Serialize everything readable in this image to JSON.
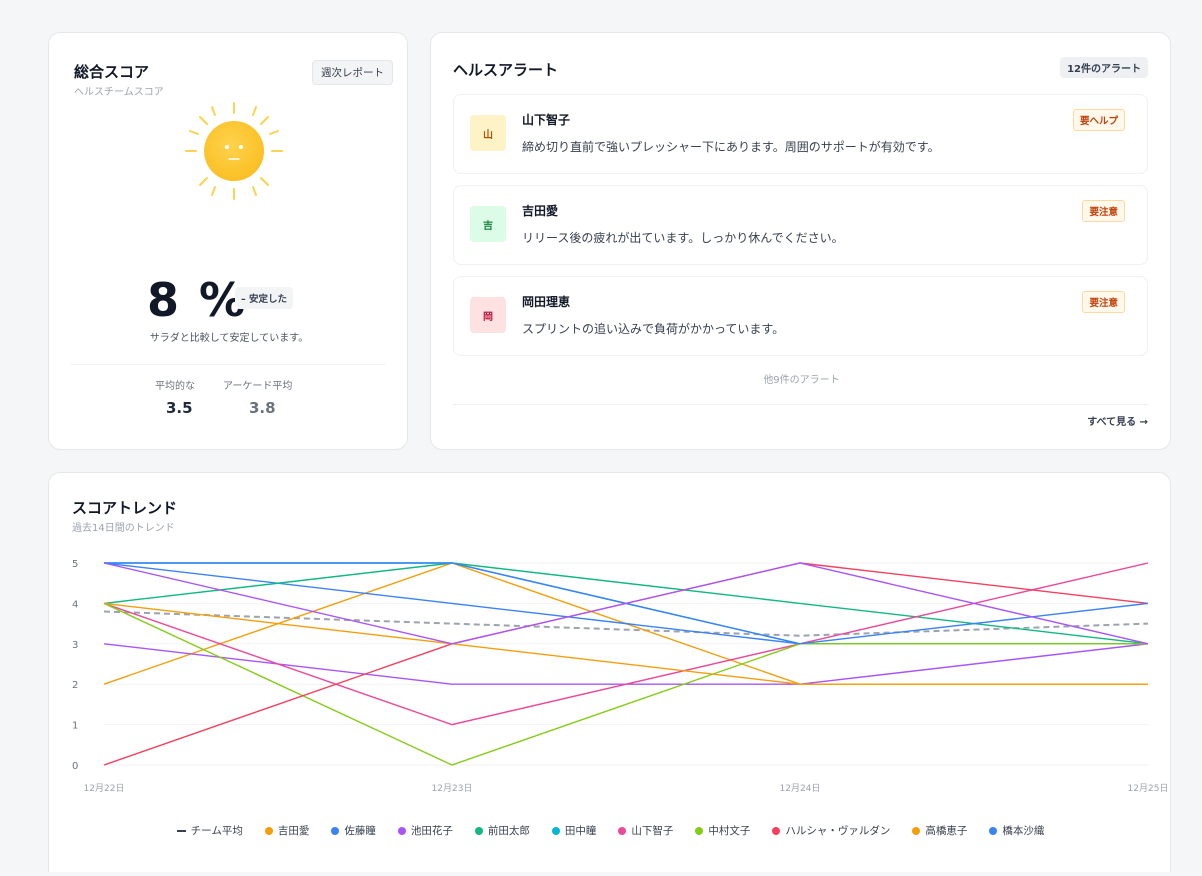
{
  "score_card": {
    "title": "総合スコア",
    "subtitle": "ヘルスチームスコア",
    "report_button": "週次レポート",
    "mood_icon": "sun-face-icon",
    "score": "8 %",
    "trend_badge": "– 安定した",
    "comparison": "サラダと比較して安定しています。",
    "stats": [
      {
        "label": "平均的な",
        "value": "3.5"
      },
      {
        "label": "アーケード平均",
        "value": "3.8"
      }
    ]
  },
  "alerts_card": {
    "title": "ヘルスアラート",
    "count_badge": "12件のアラート",
    "items": [
      {
        "avatar": "山",
        "name": "山下智子",
        "message": "締め切り直前で強いプレッシャー下にあります。周囲のサポートが有効です。",
        "tag": "要ヘルプ",
        "avatar_bg": "#fef3c7",
        "avatar_color": "#b45309"
      },
      {
        "avatar": "吉",
        "name": "吉田愛",
        "message": "リリース後の疲れが出ています。しっかり休んでください。",
        "tag": "要注意",
        "avatar_bg": "#dcfce7",
        "avatar_color": "#15803d"
      },
      {
        "avatar": "岡",
        "name": "岡田理恵",
        "message": "スプリントの追い込みで負荷がかかっています。",
        "tag": "要注意",
        "avatar_bg": "#fee2e2",
        "avatar_color": "#be123c"
      }
    ],
    "more_text": "他9件のアラート",
    "see_all": "すべて見る →"
  },
  "trend_card": {
    "title": "スコアトレンド",
    "subtitle": "過去14日間のトレンド"
  },
  "chart_data": {
    "type": "line",
    "title": "スコアトレンド",
    "subtitle": "過去14日間のトレンド",
    "x": [
      "12月22日",
      "12月23日",
      "12月24日",
      "12月25日"
    ],
    "ylim": [
      0,
      5
    ],
    "yticks": [
      "0",
      "1",
      "2",
      "3",
      "4",
      "5"
    ],
    "grid": true,
    "legend": "bottom",
    "series": [
      {
        "name": "チーム平均",
        "values": [
          3.8,
          3.5,
          3.2,
          3.5
        ],
        "color": "#9ca3af",
        "dashed": true
      },
      {
        "name": "吉田愛",
        "values": [
          2,
          5,
          2,
          2
        ],
        "color": "#f59e0b"
      },
      {
        "name": "佐藤瞳",
        "values": [
          5,
          4,
          3,
          3
        ],
        "color": "#3b82f6"
      },
      {
        "name": "池田花子",
        "values": [
          3,
          2,
          2,
          3
        ],
        "color": "#a855f7"
      },
      {
        "name": "前田太郎",
        "values": [
          4,
          5,
          4,
          3
        ],
        "color": "#10b981"
      },
      {
        "name": "田中瞳",
        "values": [
          5,
          5,
          3,
          3
        ],
        "color": "#06b6d4"
      },
      {
        "name": "山下智子",
        "values": [
          4,
          1,
          3,
          5
        ],
        "color": "#ec4899"
      },
      {
        "name": "中村文子",
        "values": [
          4,
          0,
          3,
          3
        ],
        "color": "#84cc16"
      },
      {
        "name": "ハルシャ・ヴァルダン",
        "values": [
          0,
          3,
          5,
          4
        ],
        "color": "#f43f5e"
      },
      {
        "name": "高橋恵子",
        "values": [
          4,
          3,
          2,
          2
        ],
        "color": "#f59e0b"
      },
      {
        "name": "橋本沙織",
        "values": [
          5,
          5,
          3,
          4
        ],
        "color": "#3b82f6"
      },
      {
        "name": "",
        "values": [
          5,
          3,
          5,
          3
        ],
        "color": "#a855f7"
      }
    ]
  }
}
